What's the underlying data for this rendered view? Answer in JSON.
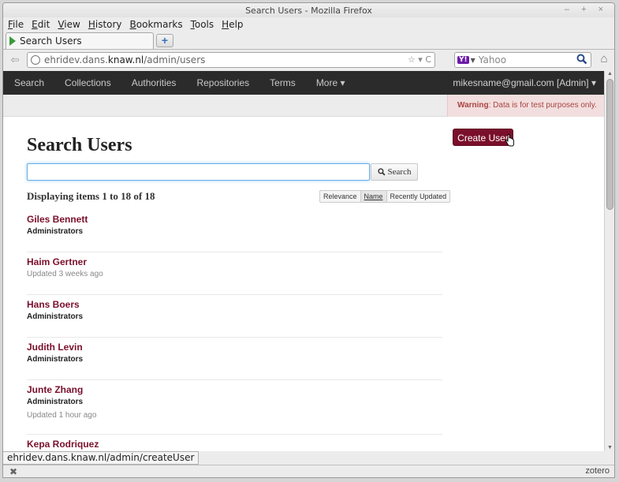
{
  "window": {
    "title": "Search Users - Mozilla Firefox",
    "controls": "– + ×"
  },
  "menu": [
    "File",
    "Edit",
    "View",
    "History",
    "Bookmarks",
    "Tools",
    "Help"
  ],
  "tab": {
    "label": "Search Users",
    "new_tab": "+"
  },
  "nav": {
    "url_prefix": "ehridev.dans.",
    "url_host": "knaw.nl",
    "url_path": "/admin/users",
    "url_tools": "☆ ▾ C",
    "search_engine": "Y!",
    "search_placeholder": "Yahoo"
  },
  "topnav": {
    "items": [
      "Search",
      "Collections",
      "Authorities",
      "Repositories",
      "Terms",
      "More ▾"
    ],
    "user": "mikesname@gmail.com [Admin] ▾"
  },
  "warning": {
    "label": "Warning",
    "text": ": Data is for test purposes only."
  },
  "page": {
    "title": "Search Users",
    "create_button": "Create User",
    "search_button": "Search",
    "search_value": "",
    "count_text": "Displaying items 1 to 18 of 18",
    "sort_options": [
      "Relevance",
      "Name",
      "Recently Updated"
    ]
  },
  "users": [
    {
      "name": "Giles Bennett",
      "group": "Administrators",
      "updated": ""
    },
    {
      "name": "Haim Gertner",
      "group": "",
      "updated": "Updated 3 weeks ago"
    },
    {
      "name": "Hans Boers",
      "group": "Administrators",
      "updated": ""
    },
    {
      "name": "Judith Levin",
      "group": "Administrators",
      "updated": ""
    },
    {
      "name": "Junte Zhang",
      "group": "Administrators",
      "updated": "Updated 1 hour ago"
    },
    {
      "name": "Kepa Rodriquez",
      "group": "",
      "updated": ""
    }
  ],
  "status": {
    "url": "ehridev.dans.knaw.nl/admin/createUser",
    "addon": "zotero"
  },
  "colors": {
    "accent": "#7a0f2b",
    "navbar": "#2b2b2b",
    "warning_bg": "#f2dede",
    "warning_text": "#a94442"
  }
}
